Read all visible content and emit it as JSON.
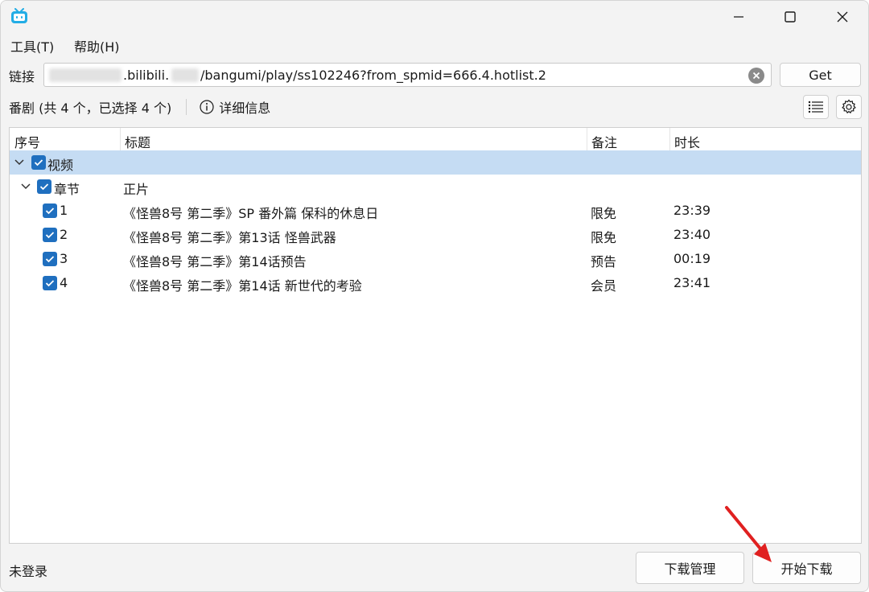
{
  "window": {
    "accent": "#1f6fbf",
    "close_icon": "close-icon",
    "maximize_icon": "maximize-icon",
    "minimize_icon": "minimize-icon"
  },
  "menu": {
    "tools": "工具(T)",
    "help": "帮助(H)"
  },
  "url_bar": {
    "label": "链接",
    "value_visible_1": ".bilibili.",
    "value_visible_2": "/bangumi/play/ss102246?from_spmid=666.4.hotlist.2",
    "get_button": "Get"
  },
  "info_bar": {
    "summary": "番剧 (共 4 个，已选择 4 个)",
    "details": "详细信息"
  },
  "table": {
    "columns": [
      "序号",
      "标题",
      "备注",
      "时长"
    ],
    "group": {
      "label": "视频"
    },
    "section": {
      "label": "章节",
      "title": "正片"
    },
    "rows": [
      {
        "index": "1",
        "title": "《怪兽8号 第二季》SP 番外篇 保科的休息日",
        "note": "限免",
        "duration": "23:39"
      },
      {
        "index": "2",
        "title": "《怪兽8号 第二季》第13话 怪兽武器",
        "note": "限免",
        "duration": "23:40"
      },
      {
        "index": "3",
        "title": "《怪兽8号 第二季》第14话预告",
        "note": "预告",
        "duration": "00:19"
      },
      {
        "index": "4",
        "title": "《怪兽8号 第二季》第14话 新世代的考验",
        "note": "会员",
        "duration": "23:41"
      }
    ]
  },
  "footer": {
    "status": "未登录",
    "download_manager": "下载管理",
    "start_download": "开始下载"
  }
}
